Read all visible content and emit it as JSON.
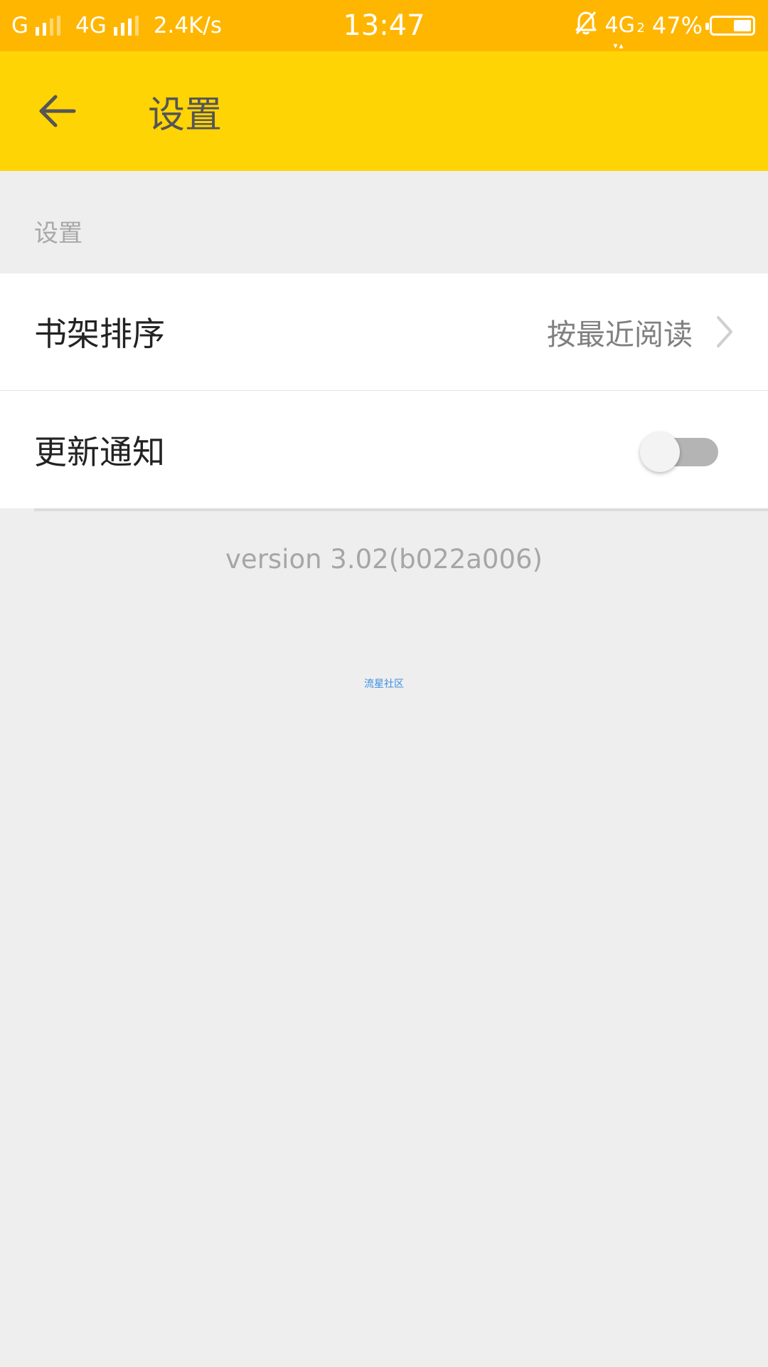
{
  "status_bar": {
    "carrier": "G",
    "network": "4G",
    "speed": "2.4K/s",
    "time": "13:47",
    "network_right": "4G",
    "sim_index": "2",
    "battery_text": "47%",
    "battery_level": 0.47,
    "icons": [
      "signal-icon",
      "signal-icon",
      "alarm-off-icon",
      "battery-icon"
    ],
    "bg_color": "#ffb600"
  },
  "app_bar": {
    "title": "设置",
    "back_icon": "arrow-left-icon",
    "bg_color": "#ffd405"
  },
  "section": {
    "header": "设置"
  },
  "settings": {
    "shelf_sort": {
      "label": "书架排序",
      "value": "按最近阅读",
      "icon": "chevron-right-icon"
    },
    "update_notify": {
      "label": "更新通知",
      "enabled": false
    }
  },
  "footer": {
    "version": "version  3.02(b022a006)",
    "community_link": "流星社区",
    "link_color": "#3a8fe0"
  }
}
